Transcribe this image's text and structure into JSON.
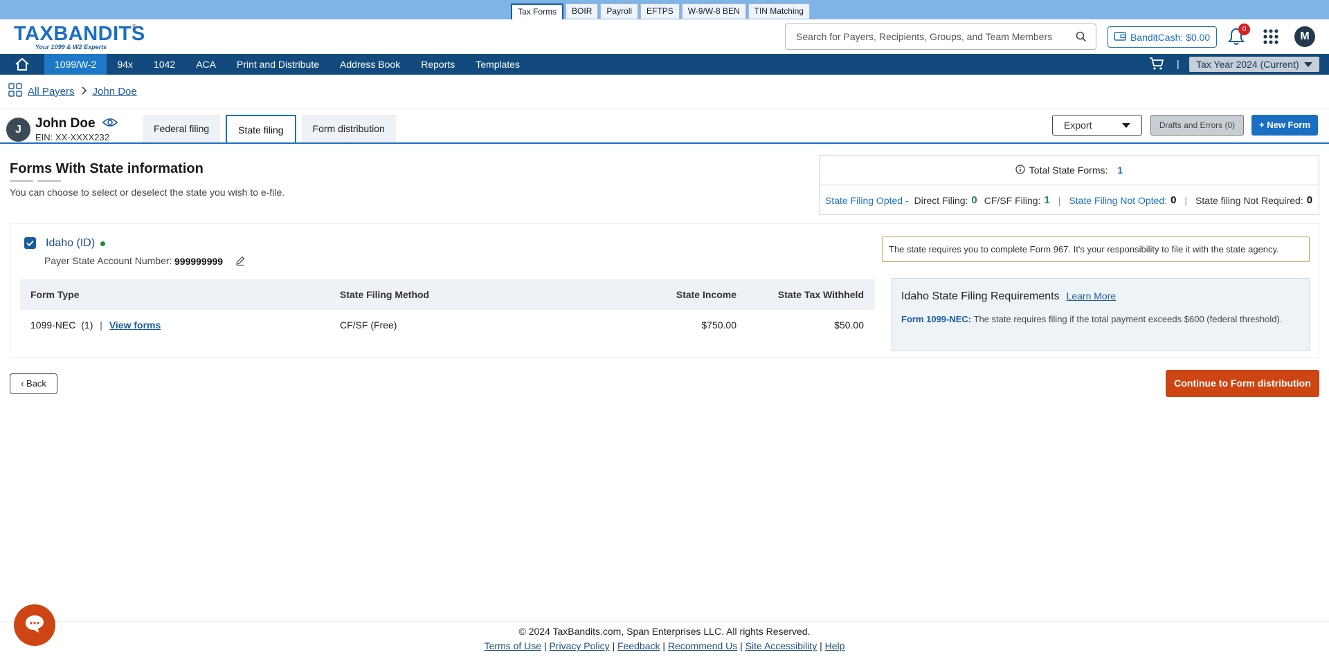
{
  "product_tabs": [
    {
      "label": "Tax Forms",
      "active": true
    },
    {
      "label": "BOIR",
      "active": false
    },
    {
      "label": "Payroll",
      "active": false
    },
    {
      "label": "EFTPS",
      "active": false
    },
    {
      "label": "W-9/W-8 BEN",
      "active": false
    },
    {
      "label": "TIN Matching",
      "active": false
    }
  ],
  "header": {
    "logo_text": "TAXBANDITS",
    "logo_tagline": "Your 1099 & W2 Experts",
    "search_placeholder": "Search for Payers, Recipients, Groups, and Team Members",
    "banditcash_label": "BanditCash: $0.00",
    "notification_count": "0",
    "avatar_initial": "M"
  },
  "nav": {
    "items": [
      "1099/W-2",
      "94x",
      "1042",
      "ACA",
      "Print and Distribute",
      "Address Book",
      "Reports",
      "Templates"
    ],
    "active_index": 0,
    "separator": "|",
    "tax_year": "Tax Year 2024 (Current)"
  },
  "breadcrumb": {
    "items": [
      "All Payers",
      "John Doe"
    ]
  },
  "payer": {
    "initial": "J",
    "name": "John Doe",
    "ein": "EIN: XX-XXXX232"
  },
  "filing_tabs": [
    {
      "label": "Federal filing",
      "active": false
    },
    {
      "label": "State filing",
      "active": true
    },
    {
      "label": "Form distribution",
      "active": false
    }
  ],
  "actions": {
    "export": "Export",
    "drafts": "Drafts and Errors (0)",
    "new_form": "New Form"
  },
  "section": {
    "title": "Forms With State information",
    "subtitle": "You can choose to select or deselect the state you wish to e-file."
  },
  "summary": {
    "total_label": "Total State Forms:",
    "total_value": "1",
    "opted_label": "State Filing Opted -",
    "direct_label": "Direct Filing:",
    "direct_value": "0",
    "cfsf_label": "CF/SF Filing:",
    "cfsf_value": "1",
    "not_opted_label": "State Filing Not Opted:",
    "not_opted_value": "0",
    "not_required_label": "State filing Not Required:",
    "not_required_value": "0"
  },
  "state": {
    "name": "Idaho (ID)",
    "checked": true,
    "account_label": "Payer State Account Number:",
    "account_value": "999999999",
    "notice": "The state requires you to complete Form 967. It's your responsibility to file it with the state agency.",
    "table": {
      "headers": [
        "Form Type",
        "State Filing Method",
        "State Income",
        "State Tax Withheld"
      ],
      "rows": [
        {
          "form_type": "1099-NEC",
          "count": "(1)",
          "separator": "|",
          "view_link": "View forms",
          "method": "CF/SF (Free)",
          "income": "$750.00",
          "withheld": "$50.00"
        }
      ]
    },
    "requirements": {
      "title": "Idaho State Filing Requirements",
      "learn_more": "Learn More",
      "form_label": "Form 1099-NEC:",
      "form_text": "The state requires filing if the total payment exceeds $600 (federal threshold)."
    }
  },
  "buttons": {
    "back": "Back",
    "continue": "Continue to Form distribution"
  },
  "footer": {
    "copyright": "© 2024 TaxBandits.com, Span Enterprises LLC. All rights Reserved.",
    "links": [
      "Terms of Use",
      "Privacy Policy",
      "Feedback",
      "Recommend Us",
      "Site Accessibility",
      "Help"
    ]
  },
  "colors": {
    "brand_blue": "#1a6fc2",
    "nav_bg": "#124a7d",
    "continue_orange": "#cc4512",
    "status_green": "#1c8a36"
  }
}
